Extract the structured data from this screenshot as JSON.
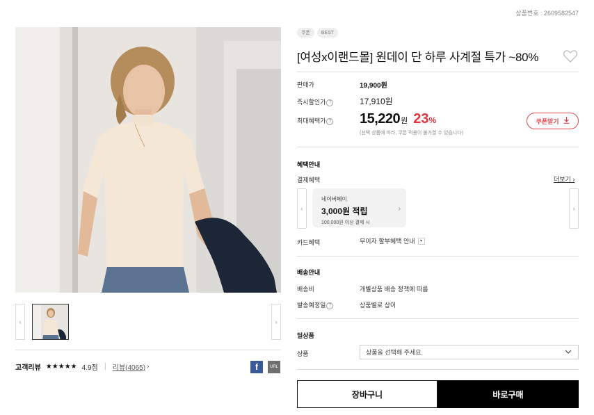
{
  "product_number": "상품번호 : 2609582547",
  "badges": [
    "쿠폰",
    "BEST"
  ],
  "title": "[여성x이랜드몰] 원데이 단 하루 사계절 특가 ~80%",
  "prices": {
    "sale_label": "판매가",
    "sale_value": "19,900원",
    "instant_label": "즉시할인가",
    "instant_value": "17,910원",
    "max_label": "최대혜택가",
    "max_value": "15,220",
    "max_unit": "원",
    "discount_pct": "23",
    "discount_unit": "%",
    "note": "(선택 상품에 따라, 쿠폰 적용이 불가할 수 있습니다)",
    "coupon_button": "쿠폰받기"
  },
  "benefits": {
    "section_title": "혜택안내",
    "payment_label": "결제혜택",
    "more_link": "더보기",
    "card": {
      "name": "네이버페이",
      "amount": "3,000원 적립",
      "condition": "100,000원 이상 결제 시"
    },
    "card_benefit_label": "카드혜택",
    "card_benefit_value": "무이자 할부혜택 안내"
  },
  "shipping": {
    "section_title": "배송안내",
    "fee_label": "배송비",
    "fee_value": "개별상품 배송 정책에 따름",
    "date_label": "발송예정일",
    "date_value": "상품별로 상이"
  },
  "option": {
    "section_title": "딜상품",
    "product_label": "상품",
    "select_placeholder": "상품을 선택해 주세요."
  },
  "actions": {
    "cart": "장바구니",
    "buy": "바로구매"
  },
  "review": {
    "label": "고객리뷰",
    "stars": "★★★★★",
    "rating": 4.9,
    "score_text": "4.9점",
    "count_link": "리뷰(4065)"
  },
  "share": {
    "facebook": "f",
    "url": "URL"
  },
  "colors": {
    "accent_red": "#e0343d",
    "facebook_blue": "#3b5a9a",
    "buy_button": "#000000"
  }
}
